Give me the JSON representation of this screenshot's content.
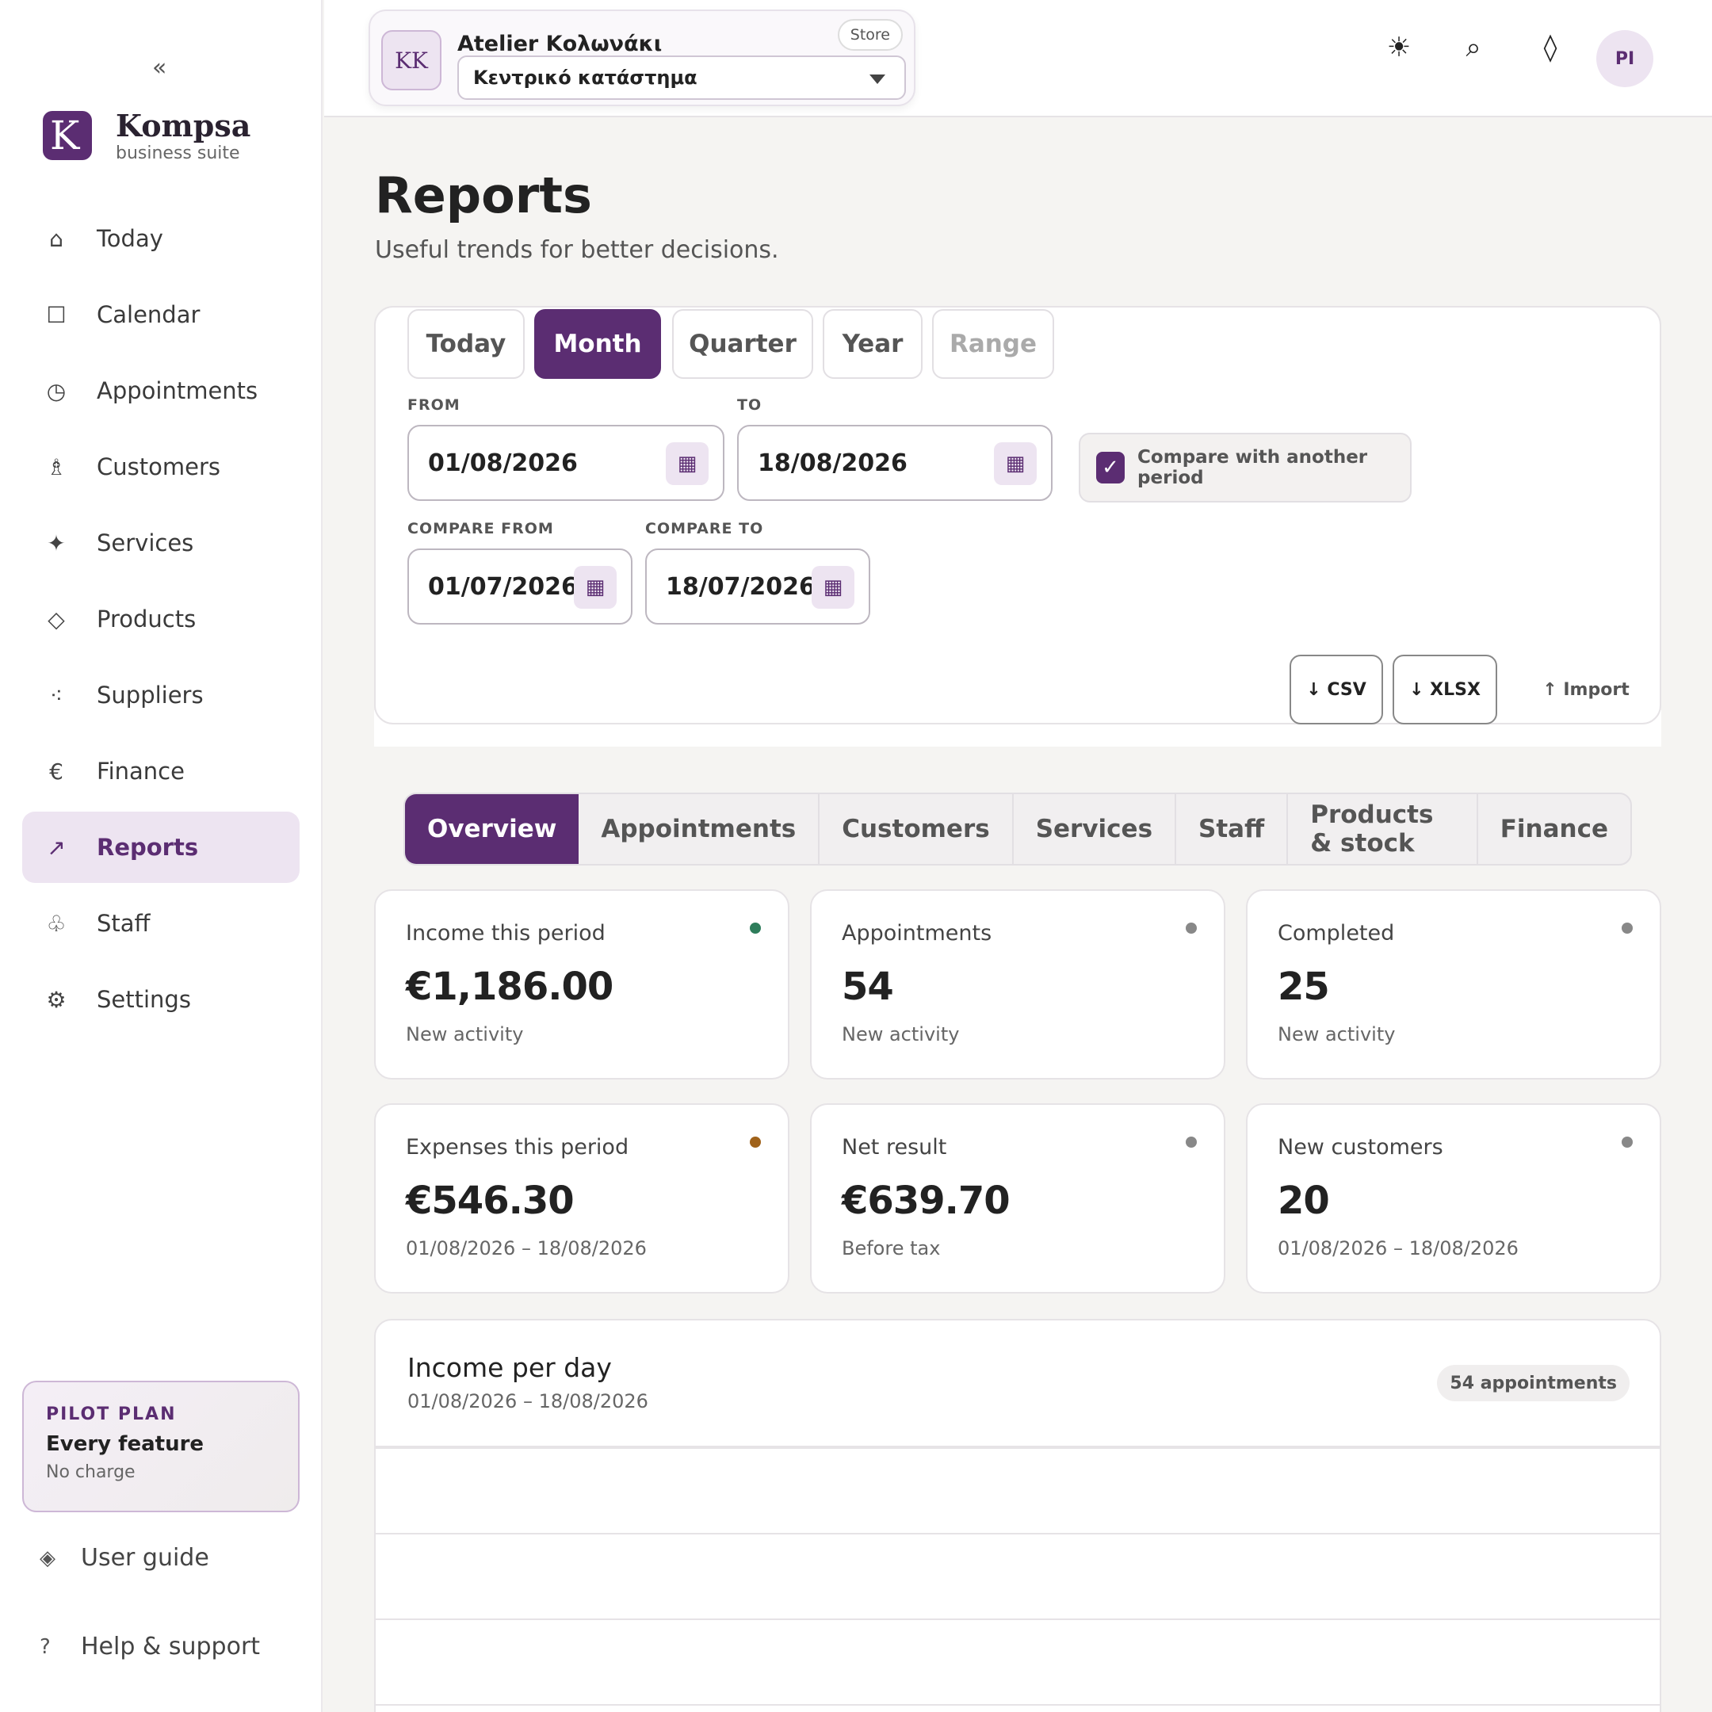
{
  "sidebar": {
    "collapse_icon": "«",
    "brand": {
      "logo_letter": "K",
      "name": "Kompsa",
      "subtitle": "business suite"
    },
    "items": [
      {
        "label": "Today",
        "icon": "home-icon",
        "glyph": "⌂"
      },
      {
        "label": "Calendar",
        "icon": "calendar-icon",
        "glyph": "☐"
      },
      {
        "label": "Appointments",
        "icon": "clock-icon",
        "glyph": "◷"
      },
      {
        "label": "Customers",
        "icon": "person-icon",
        "glyph": "♗"
      },
      {
        "label": "Services",
        "icon": "sparkle-icon",
        "glyph": "✦"
      },
      {
        "label": "Products",
        "icon": "diamond-icon",
        "glyph": "◇"
      },
      {
        "label": "Suppliers",
        "icon": "dots-icon",
        "glyph": "⁖"
      },
      {
        "label": "Finance",
        "icon": "euro-icon",
        "glyph": "€"
      },
      {
        "label": "Reports",
        "icon": "trend-arrow-icon",
        "glyph": "↗",
        "active": true
      },
      {
        "label": "Staff",
        "icon": "staff-icon",
        "glyph": "♧"
      },
      {
        "label": "Settings",
        "icon": "gear-icon",
        "glyph": "⚙"
      }
    ],
    "plan": {
      "tag": "PILOT PLAN",
      "title": "Every feature",
      "subtitle": "No charge"
    },
    "user_guide": {
      "glyph": "◈",
      "label": "User guide"
    },
    "help": {
      "glyph": "?",
      "label": "Help & support"
    }
  },
  "topbar": {
    "store": {
      "initials": "KK",
      "name": "Atelier Κολωνάκι",
      "badge": "Store",
      "location": "Κεντρικό κατάστημα"
    },
    "icons": {
      "theme": "☀",
      "search": "⌕",
      "diamond": "◊"
    },
    "user_initials": "PI"
  },
  "page": {
    "title": "Reports",
    "subtitle": "Useful trends for better decisions."
  },
  "filters": {
    "period_tabs": [
      {
        "label": "Today"
      },
      {
        "label": "Month",
        "active": true
      },
      {
        "label": "Quarter"
      },
      {
        "label": "Year"
      },
      {
        "label": "Range",
        "disabled": true
      }
    ],
    "from_label": "FROM",
    "from_value": "01/08/2026",
    "to_label": "TO",
    "to_value": "18/08/2026",
    "compare_label": "Compare with another period",
    "compare_checked": true,
    "compare_from_label": "COMPARE FROM",
    "compare_from_value": "01/07/2026",
    "compare_to_label": "COMPARE TO",
    "compare_to_value": "18/07/2026",
    "calendar_glyph": "▦",
    "check_glyph": "✓",
    "export_csv": "↓ CSV",
    "export_xlsx": "↓ XLSX",
    "import": "↑ Import"
  },
  "section_tabs": [
    {
      "label": "Overview",
      "active": true
    },
    {
      "label": "Appointments"
    },
    {
      "label": "Customers"
    },
    {
      "label": "Services"
    },
    {
      "label": "Staff"
    },
    {
      "label": "Products & stock"
    },
    {
      "label": "Finance"
    }
  ],
  "kpis": [
    {
      "label": "Income this period",
      "value": "€1,186.00",
      "note": "New activity",
      "dot_color": "#2e7d5b"
    },
    {
      "label": "Appointments",
      "value": "54",
      "note": "New activity",
      "dot_color": "#888888"
    },
    {
      "label": "Completed",
      "value": "25",
      "note": "New activity",
      "dot_color": "#888888"
    },
    {
      "label": "Expenses this period",
      "value": "€546.30",
      "note": "01/08/2026 – 18/08/2026",
      "dot_color": "#a0621a"
    },
    {
      "label": "Net result",
      "value": "€639.70",
      "note": "Before tax",
      "dot_color": "#888888"
    },
    {
      "label": "New customers",
      "value": "20",
      "note": "01/08/2026 – 18/08/2026",
      "dot_color": "#888888"
    }
  ],
  "chart": {
    "title": "Income per day",
    "range": "01/08/2026 – 18/08/2026",
    "badge": "54 appointments"
  },
  "colors": {
    "accent": "#5b2d72",
    "accent_soft": "#ede4f1",
    "background": "#f5f4f2"
  }
}
